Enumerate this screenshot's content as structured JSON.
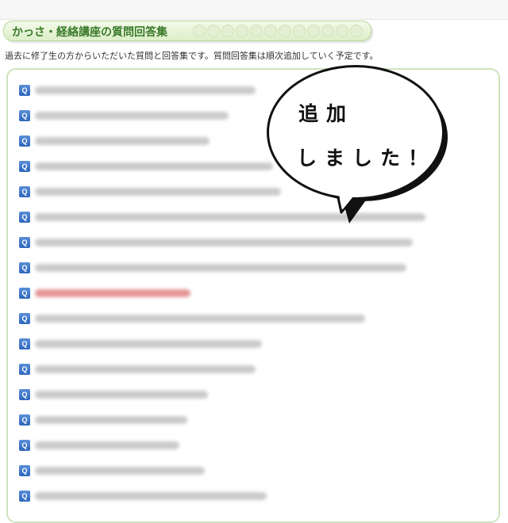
{
  "header": {
    "title": "かっさ・経絡講座の質問回答集",
    "intro": "過去に修了生の方からいただいた質問と回答集です。質問回答集は順次追加していく予定です。"
  },
  "qa": {
    "icon_label": "Q",
    "icon_color": "#3b73c8",
    "highlight_color": "#d04040",
    "items_count_visible": 17
  },
  "callout": {
    "line1": "追加",
    "line2": "しました！"
  }
}
